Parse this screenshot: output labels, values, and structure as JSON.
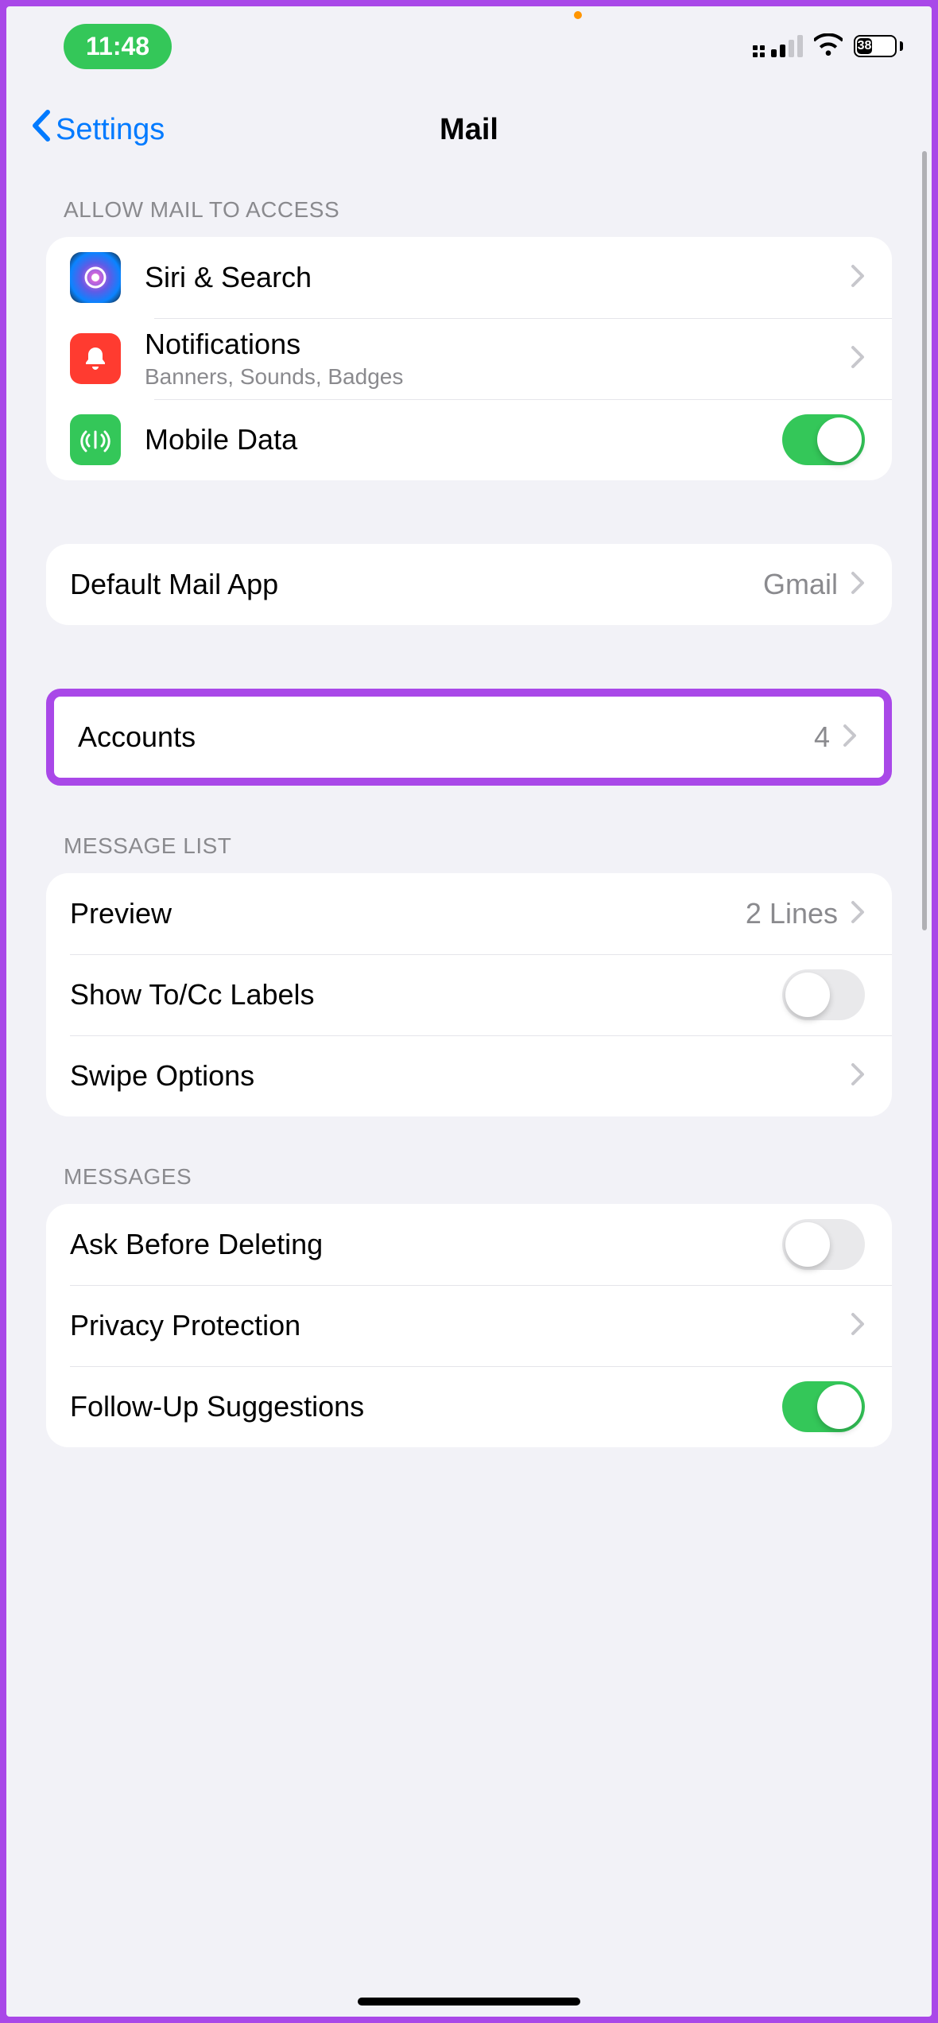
{
  "status": {
    "time": "11:48",
    "battery_pct": "38"
  },
  "nav": {
    "back_label": "Settings",
    "title": "Mail"
  },
  "sections": {
    "access_header": "ALLOW MAIL TO ACCESS",
    "message_list_header": "MESSAGE LIST",
    "messages_header": "MESSAGES"
  },
  "rows": {
    "siri": {
      "label": "Siri & Search"
    },
    "notifications": {
      "label": "Notifications",
      "sub": "Banners, Sounds, Badges"
    },
    "mobile_data": {
      "label": "Mobile Data",
      "on": true
    },
    "default_app": {
      "label": "Default Mail App",
      "value": "Gmail"
    },
    "accounts": {
      "label": "Accounts",
      "value": "4"
    },
    "preview": {
      "label": "Preview",
      "value": "2 Lines"
    },
    "show_to_cc": {
      "label": "Show To/Cc Labels",
      "on": false
    },
    "swipe": {
      "label": "Swipe Options"
    },
    "ask_delete": {
      "label": "Ask Before Deleting",
      "on": false
    },
    "privacy": {
      "label": "Privacy Protection"
    },
    "followup": {
      "label": "Follow-Up Suggestions",
      "on": true
    }
  }
}
